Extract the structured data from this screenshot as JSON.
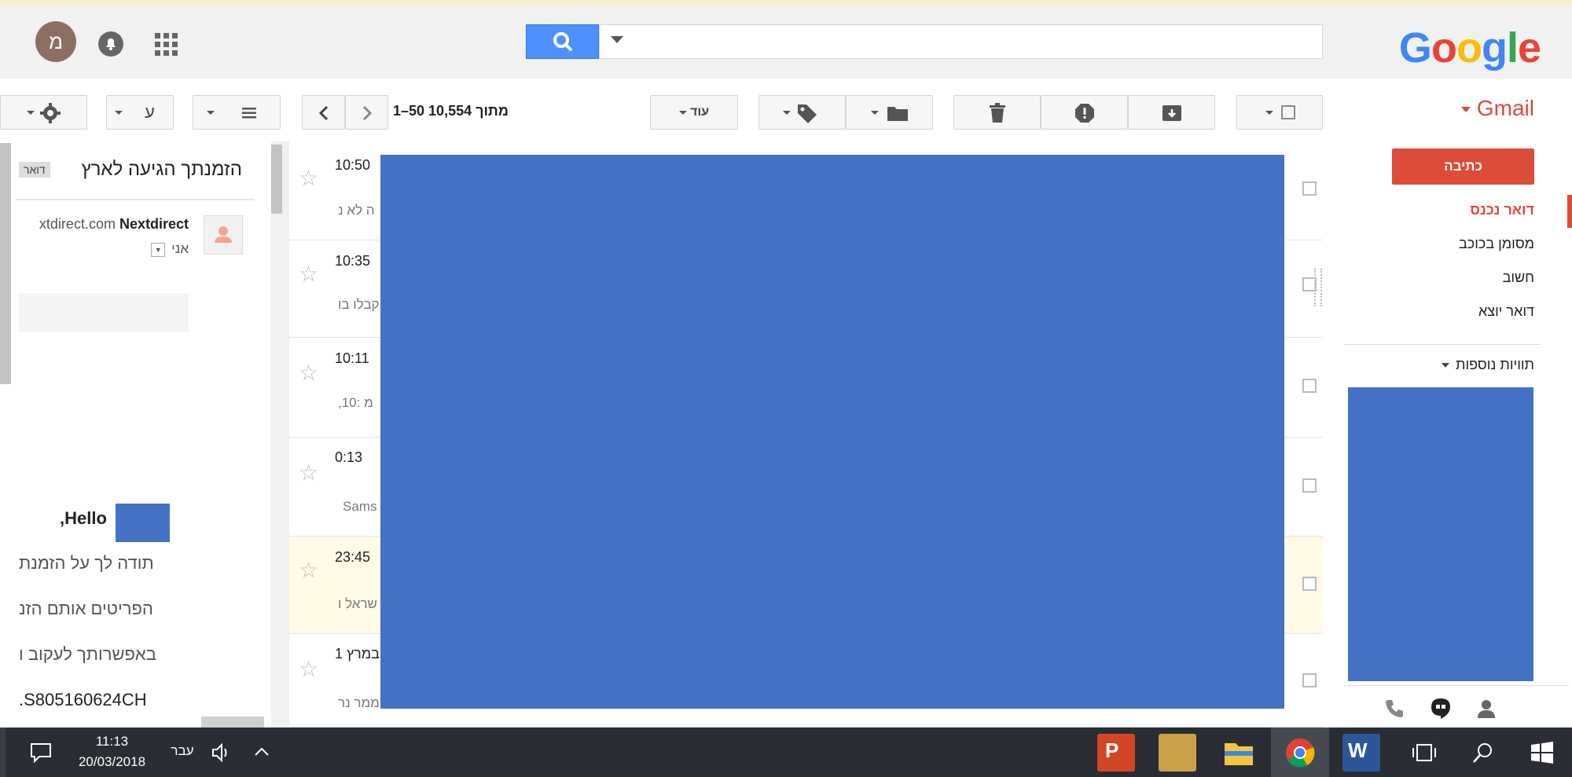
{
  "header": {
    "logo_text": "Google",
    "avatar_initial": "מ"
  },
  "toolbar": {
    "pagination": "1–50 מתוך 10,554",
    "more_label": "עוד",
    "lang_label": "ע"
  },
  "sidebar": {
    "app_name": "Gmail",
    "compose_label": "כתיבה",
    "items": [
      {
        "label": "דואר נכנס",
        "active": true
      },
      {
        "label": "מסומן בכוכב",
        "active": false
      },
      {
        "label": "חשוב",
        "active": false
      },
      {
        "label": "דואר יוצא",
        "active": false
      }
    ],
    "more_labels": "תוויות נוספות"
  },
  "message_list": [
    {
      "time": "10:50",
      "snippet": "ה לא נ"
    },
    {
      "time": "10:35",
      "snippet": "קבלו בו"
    },
    {
      "time": "10:11",
      "snippet": ",10: מ"
    },
    {
      "time": "0:13",
      "snippet": "Sams"
    },
    {
      "time": "23:45",
      "snippet": "שראל ו",
      "highlighted": true
    },
    {
      "time": "1 במרץ",
      "snippet": "ממר נר"
    }
  ],
  "reading_pane": {
    "subject": "הזמנתך הגיעה לארץ",
    "label_badge": "דואר",
    "sender_name": "Nextdirect",
    "sender_email": "xtdirect.com",
    "to_me": "אני",
    "greeting": "Hello",
    "greeting_punct": ",",
    "body_lines": [
      "תודה לך על הזמנת",
      "הפריטים אותם הזנ",
      "באפשרותך לעקוב ו",
      ".S805160624CH"
    ]
  },
  "taskbar": {
    "time": "11:13",
    "date": "20/03/2018",
    "language": "עבר"
  },
  "colors": {
    "gmail_red": "#dd4b39",
    "redaction": "#4472c4",
    "search_blue": "#4d90fe"
  }
}
